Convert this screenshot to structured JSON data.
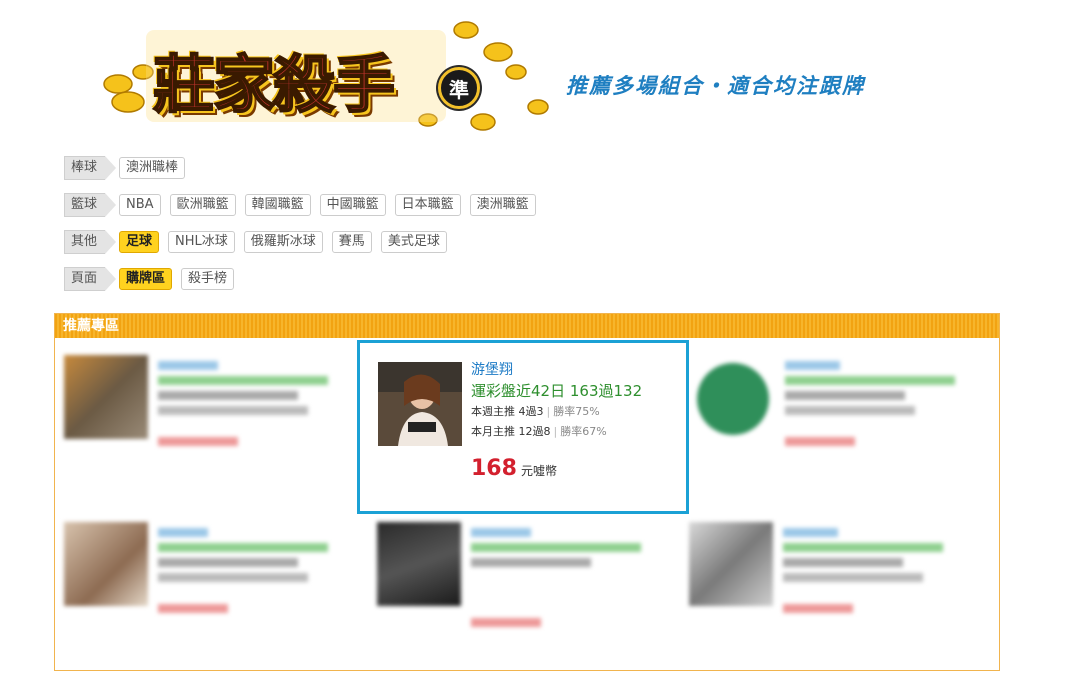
{
  "logo": {
    "title": "莊家殺手",
    "badge": "準"
  },
  "slogan": "推薦多場組合・適合均注跟牌",
  "filters": [
    {
      "label": "棒球",
      "items": [
        {
          "text": "澳洲職棒",
          "active": false
        }
      ]
    },
    {
      "label": "籃球",
      "items": [
        {
          "text": "NBA",
          "active": false
        },
        {
          "text": "歐洲職籃",
          "active": false
        },
        {
          "text": "韓國職籃",
          "active": false
        },
        {
          "text": "中國職籃",
          "active": false
        },
        {
          "text": "日本職籃",
          "active": false
        },
        {
          "text": "澳洲職籃",
          "active": false
        }
      ]
    },
    {
      "label": "其他",
      "items": [
        {
          "text": "足球",
          "active": true
        },
        {
          "text": "NHL冰球",
          "active": false
        },
        {
          "text": "俄羅斯冰球",
          "active": false
        },
        {
          "text": "賽馬",
          "active": false
        },
        {
          "text": "美式足球",
          "active": false
        }
      ]
    },
    {
      "label": "頁面",
      "items": [
        {
          "text": "購牌區",
          "active": true
        },
        {
          "text": "殺手榜",
          "active": false
        }
      ]
    }
  ],
  "panel": {
    "title": "推薦專區"
  },
  "featured": {
    "name": "游堡翔",
    "record": "運彩盤近42日 163過132",
    "week_main": "本週主推 4過3",
    "week_rate": "勝率75%",
    "month_main": "本月主推 12過8",
    "month_rate": "勝率67%",
    "price": "168",
    "price_unit": "元噓幣"
  },
  "colors": {
    "accent": "#f2a312",
    "featured_border": "#1ba1d5",
    "price": "#d3202e",
    "name": "#1d7bc6",
    "record": "#2e8f2e"
  }
}
